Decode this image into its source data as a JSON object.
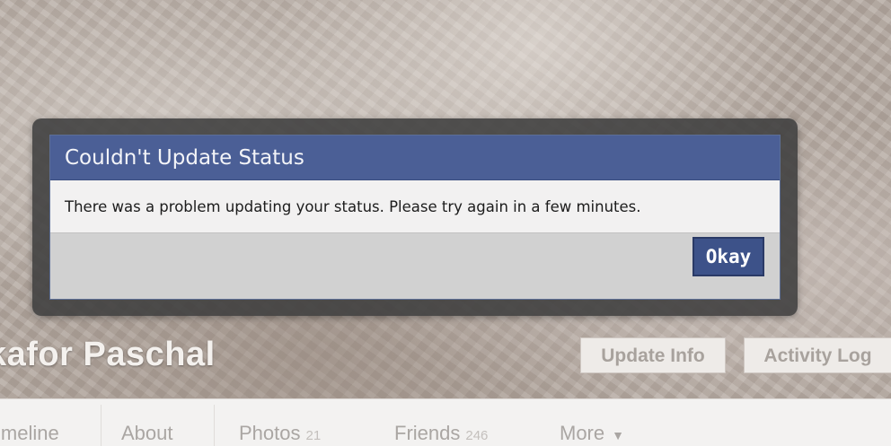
{
  "profile": {
    "name": "kafor Paschal",
    "update_info_label": "Update Info",
    "activity_log_label": "Activity Log"
  },
  "tabs": [
    {
      "label": "imeline"
    },
    {
      "label": "About"
    },
    {
      "label": "Photos",
      "count": "21"
    },
    {
      "label": "Friends",
      "count": "246"
    },
    {
      "label": "More",
      "icon": "chevron-down-icon"
    }
  ],
  "dialog": {
    "title": "Couldn't Update Status",
    "message": "There was a problem updating your status. Please try again in a few minutes.",
    "okay_label": "Okay"
  },
  "colors": {
    "dialog_header": "#4b5f96",
    "okay_button": "#3d5289"
  }
}
